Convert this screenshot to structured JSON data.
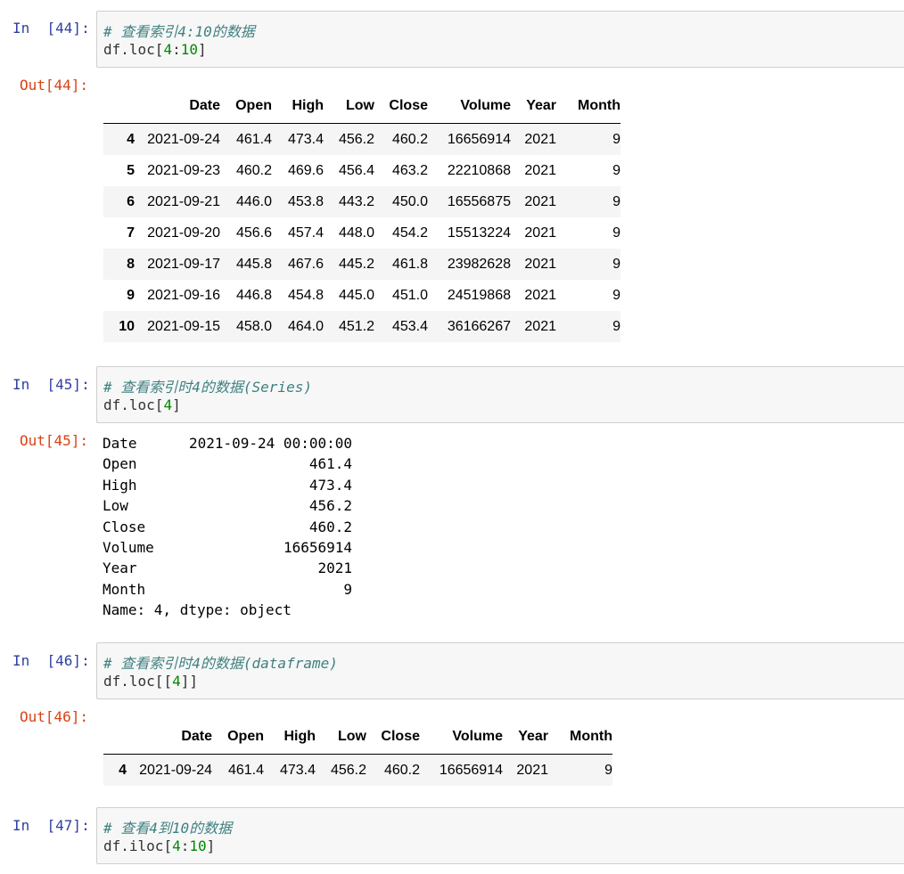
{
  "cells": [
    {
      "in_prompt": "In  [44]:",
      "comment": "# 查看索引4:10的数据",
      "code": [
        "df.",
        "loc[",
        "4",
        ":",
        "10",
        "]"
      ],
      "out_prompt": "Out[44]:"
    },
    {
      "in_prompt": "In  [45]:",
      "comment": "# 查看索引时4的数据(Series)",
      "code": [
        "df.",
        "loc[",
        "4",
        "]"
      ],
      "out_prompt": "Out[45]:"
    },
    {
      "in_prompt": "In  [46]:",
      "comment": "# 查看索引时4的数据(dataframe)",
      "code": [
        "df.",
        "loc[[",
        "4",
        "]]"
      ],
      "out_prompt": "Out[46]:"
    },
    {
      "in_prompt": "In  [47]:",
      "comment": "# 查看4到10的数据",
      "code": [
        "df.",
        "iloc[",
        "4",
        ":",
        "10",
        "]"
      ]
    }
  ],
  "columns": [
    "",
    "Date",
    "Open",
    "High",
    "Low",
    "Close",
    "Volume",
    "Year",
    "Month"
  ],
  "table1_rows": [
    [
      "4",
      "2021-09-24",
      "461.4",
      "473.4",
      "456.2",
      "460.2",
      "16656914",
      "2021",
      "9"
    ],
    [
      "5",
      "2021-09-23",
      "460.2",
      "469.6",
      "456.4",
      "463.2",
      "22210868",
      "2021",
      "9"
    ],
    [
      "6",
      "2021-09-21",
      "446.0",
      "453.8",
      "443.2",
      "450.0",
      "16556875",
      "2021",
      "9"
    ],
    [
      "7",
      "2021-09-20",
      "456.6",
      "457.4",
      "448.0",
      "454.2",
      "15513224",
      "2021",
      "9"
    ],
    [
      "8",
      "2021-09-17",
      "445.8",
      "467.6",
      "445.2",
      "461.8",
      "23982628",
      "2021",
      "9"
    ],
    [
      "9",
      "2021-09-16",
      "446.8",
      "454.8",
      "445.0",
      "451.0",
      "24519868",
      "2021",
      "9"
    ],
    [
      "10",
      "2021-09-15",
      "458.0",
      "464.0",
      "451.2",
      "453.4",
      "36166267",
      "2021",
      "9"
    ]
  ],
  "series_rows": [
    {
      "key": "Date",
      "value": "2021-09-24 00:00:00"
    },
    {
      "key": "Open",
      "value": "461.4"
    },
    {
      "key": "High",
      "value": "473.4"
    },
    {
      "key": "Low",
      "value": "456.2"
    },
    {
      "key": "Close",
      "value": "460.2"
    },
    {
      "key": "Volume",
      "value": "16656914"
    },
    {
      "key": "Year",
      "value": "2021"
    },
    {
      "key": "Month",
      "value": "9"
    }
  ],
  "series_footer": "Name: 4, dtype: object",
  "table3_rows": [
    [
      "4",
      "2021-09-24",
      "461.4",
      "473.4",
      "456.2",
      "460.2",
      "16656914",
      "2021",
      "9"
    ]
  ],
  "colors": {
    "in_prompt": "#303f9f",
    "out_prompt": "#d84315",
    "comment": "#408080",
    "number": "#008800",
    "cell_background": "#f7f7f7"
  }
}
